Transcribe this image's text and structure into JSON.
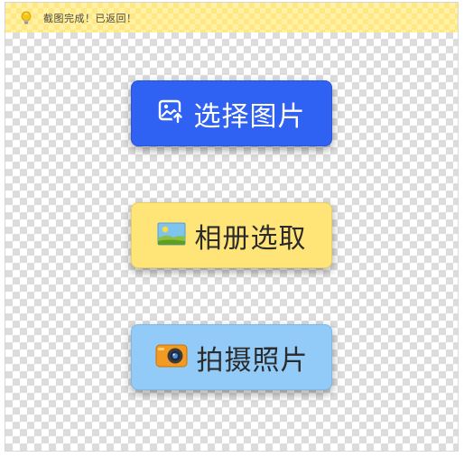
{
  "notice": {
    "text": "截图完成！已返回！",
    "icon": "lightbulb-icon"
  },
  "buttons": {
    "select_image": {
      "label": "选择图片",
      "icon": "image-upload-icon",
      "color": "#2f62f2"
    },
    "album": {
      "label": "相册选取",
      "icon": "landscape-photo-icon",
      "color": "#ffe578"
    },
    "camera": {
      "label": "拍摄照片",
      "icon": "camera-icon",
      "color": "#92cbf8"
    }
  }
}
